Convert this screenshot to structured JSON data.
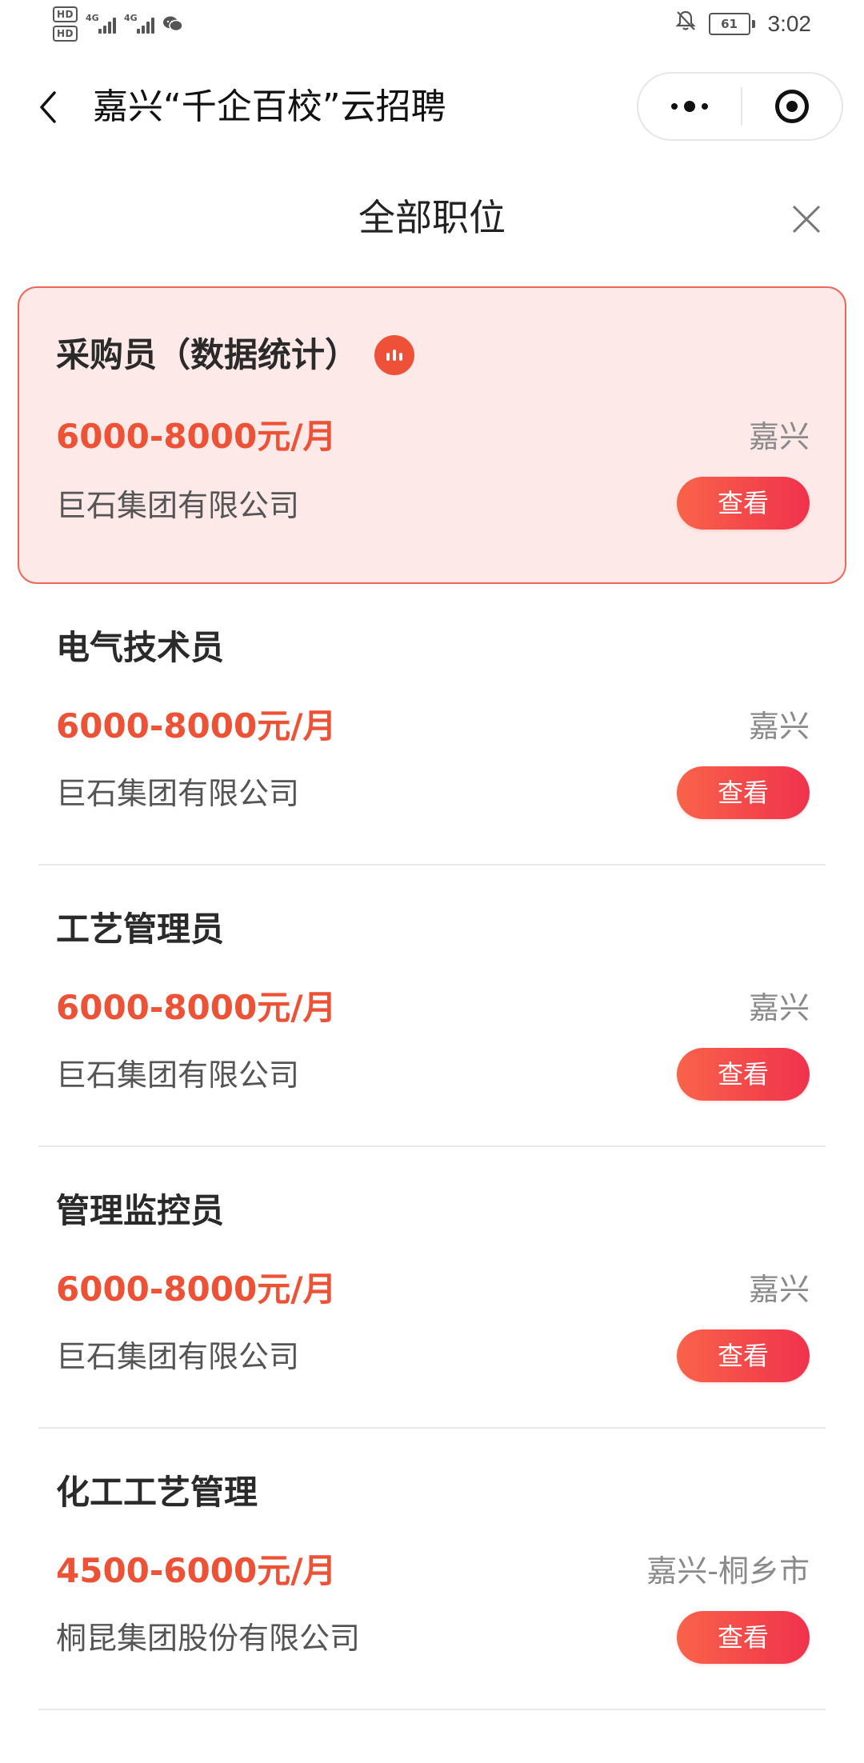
{
  "status_bar": {
    "network_1": "4G",
    "network_2": "4G",
    "battery": "61",
    "time": "3:02"
  },
  "nav": {
    "title": "嘉兴“千企百校”云招聘"
  },
  "sheet": {
    "title": "全部职位"
  },
  "colors": {
    "accent": "#ee5236",
    "active_bg": "#fdeae8",
    "active_border": "#f0675a"
  },
  "jobs": [
    {
      "title": "采购员（数据统计）",
      "salary": "6000-8000元/月",
      "location": "嘉兴",
      "company": "巨石集团有限公司",
      "button": "查看",
      "active": true
    },
    {
      "title": "电气技术员",
      "salary": "6000-8000元/月",
      "location": "嘉兴",
      "company": "巨石集团有限公司",
      "button": "查看"
    },
    {
      "title": "工艺管理员",
      "salary": "6000-8000元/月",
      "location": "嘉兴",
      "company": "巨石集团有限公司",
      "button": "查看"
    },
    {
      "title": "管理监控员",
      "salary": "6000-8000元/月",
      "location": "嘉兴",
      "company": "巨石集团有限公司",
      "button": "查看"
    },
    {
      "title": "化工工艺管理",
      "salary": "4500-6000元/月",
      "location": "嘉兴-桐乡市",
      "company": "桐昆集团股份有限公司",
      "button": "查看"
    }
  ]
}
